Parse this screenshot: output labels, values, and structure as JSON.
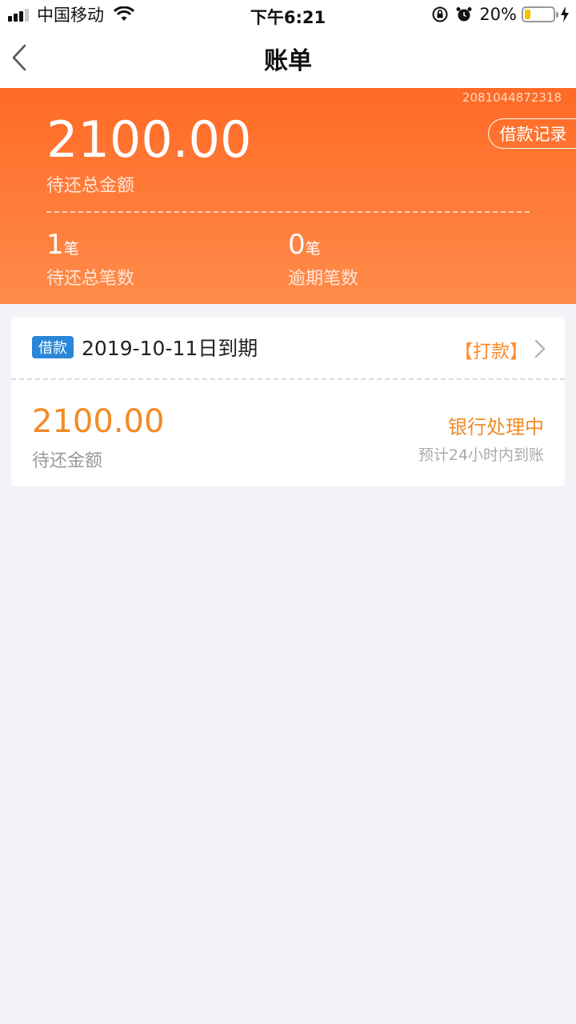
{
  "status_bar": {
    "carrier": "中国移动",
    "time": "下午6:21",
    "battery": "20%"
  },
  "nav": {
    "title": "账单"
  },
  "summary": {
    "serial": "2081044872318",
    "record_button": "借款记录",
    "total_amount": "2100.00",
    "total_label": "待还总金额",
    "pending_count": "1",
    "pending_unit": "笔",
    "pending_label": "待还总笔数",
    "overdue_count": "0",
    "overdue_unit": "笔",
    "overdue_label": "逾期笔数"
  },
  "bill": {
    "tag": "借款",
    "due": "2019-10-11日到期",
    "action": "【打款】",
    "amount": "2100.00",
    "amount_label": "待还金额",
    "status": "银行处理中",
    "status_sub": "预计24小时内到账"
  },
  "colors": {
    "banner_top": "#ff6a26",
    "banner_bottom": "#ff8b4a",
    "accent": "#f28b26",
    "tag_blue": "#2a86d8"
  }
}
